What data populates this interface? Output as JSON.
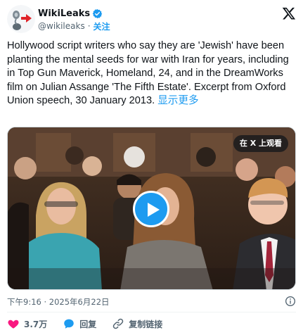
{
  "account": {
    "display_name": "WikiLeaks",
    "handle": "@wikileaks",
    "separator": "·",
    "follow_label": "关注"
  },
  "tweet": {
    "text": "Hollywood script writers who say they are 'Jewish' have been planting the mental seeds for war with Iran for years, including in Top Gun Maverick, Homeland, 24, and in the DreamWorks film on Julian Assange 'The Fifth Estate'. Excerpt from Oxford Union speech, 30 January 2013. ",
    "show_more_label": "显示更多"
  },
  "media": {
    "watch_on_x_label": "在 X 上观看"
  },
  "meta": {
    "timestamp": "下午9:16 · 2025年6月22日"
  },
  "actions": {
    "like_count": "3.7万",
    "reply_label": "回复",
    "copy_link_label": "复制链接"
  },
  "colors": {
    "accent": "#1d9bf0",
    "like": "#f91880",
    "text": "#0f1419",
    "secondary": "#536471"
  },
  "icons": [
    "verified-badge-icon",
    "x-logo-icon",
    "play-icon",
    "info-icon",
    "heart-icon",
    "reply-bubble-icon",
    "link-icon"
  ]
}
